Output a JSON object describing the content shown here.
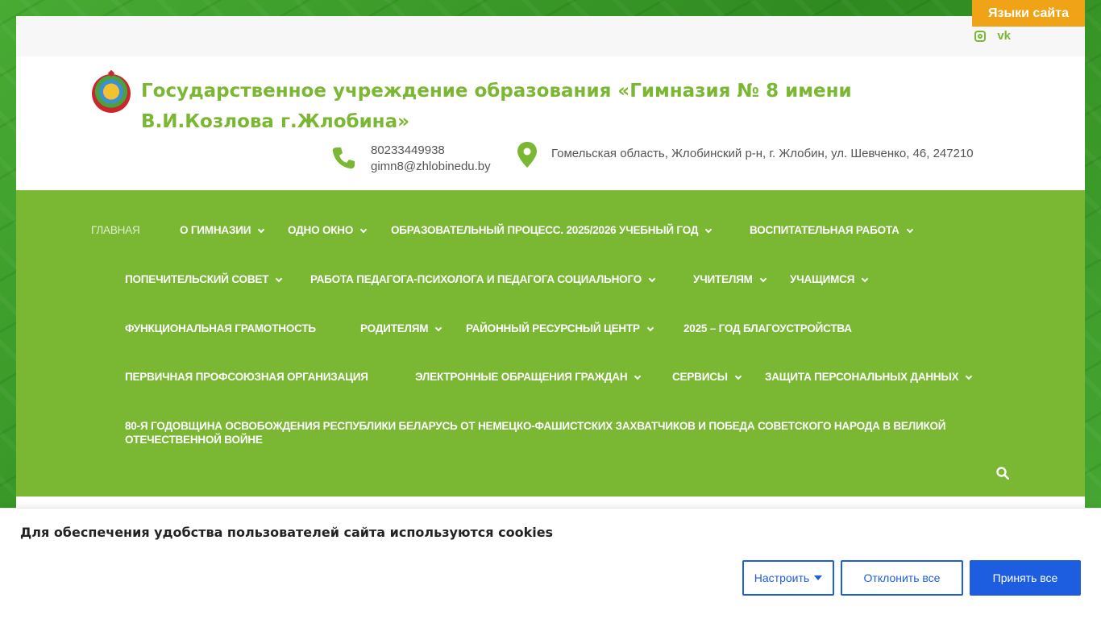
{
  "lang_button": "Языки сайта",
  "social": {
    "instagram_icon": "instagram-icon",
    "vk_label": "vk"
  },
  "header": {
    "title": "Государственное учреждение образования «Гимназия № 8 имени В.И.Козлова г.Жлобина»",
    "phone": "80233449938",
    "email": "gimn8@zhlobinedu.by",
    "address": "Гомельская область, Жлобинский р-н, г. Жлобин, ул. Шевченко, 46, 247210"
  },
  "nav": {
    "items": [
      "Главная",
      "О гимназии",
      "Одно окно",
      "Образовательный процесс. 2025/2026 учебный год",
      "Воспитательная работа",
      "Попечительский совет",
      "Работа педагога-психолога и педагога социального",
      "Учителям",
      "Учащимся",
      "Функциональная грамотность",
      "Родителям",
      "Районный ресурсный центр",
      "2025 – Год благоустройства",
      "Первичная профсоюзная организация",
      "Электронные обращения граждан",
      "Сервисы",
      "Защита персональных данных",
      "80-я годовщина освобождения Республики Беларусь от немецко-фашистских захватчиков и Победа советского народа в Великой Отечественной войне"
    ]
  },
  "cookie": {
    "text": "Для обеспечения удобства пользователей сайта используются cookies",
    "settings": "Настроить",
    "reject": "Отклонить все",
    "accept": "Принять все"
  },
  "colors": {
    "brand_green": "#7ab733",
    "lang_orange": "#f0a316",
    "cookie_blue": "#1d5ee0"
  }
}
